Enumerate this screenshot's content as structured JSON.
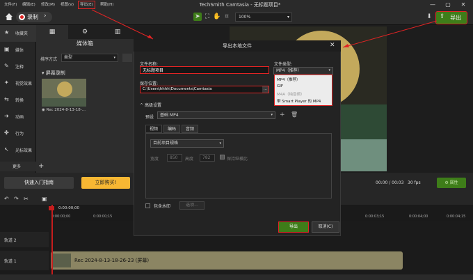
{
  "menu": {
    "items": [
      "文件(F)",
      "编辑(E)",
      "修改(M)",
      "视图(V)",
      "导出(E)",
      "帮助(H)"
    ],
    "highlighted_index": 4
  },
  "window": {
    "title": "TechSmith Camtasia - 无标题项目*",
    "minimize": "—",
    "maximize": "▢",
    "close": "✕"
  },
  "toolbar": {
    "record_label": "录制",
    "zoom_value": "100%",
    "export_label": "导出"
  },
  "sidebar": {
    "items": [
      {
        "label": "收藏夹",
        "icon": "star-icon",
        "glyph": "★"
      },
      {
        "label": "媒体",
        "icon": "media-icon",
        "glyph": "▣"
      },
      {
        "label": "注释",
        "icon": "annotation-icon",
        "glyph": "✎"
      },
      {
        "label": "视觉效果",
        "icon": "visual-effects-icon",
        "glyph": "✦"
      },
      {
        "label": "转换",
        "icon": "transition-icon",
        "glyph": "⇆"
      },
      {
        "label": "动画",
        "icon": "animation-icon",
        "glyph": "➜"
      },
      {
        "label": "行为",
        "icon": "behavior-icon",
        "glyph": "✤"
      },
      {
        "label": "光标效果",
        "icon": "cursor-effects-icon",
        "glyph": "↖"
      }
    ],
    "more_label": "更多"
  },
  "media_bin": {
    "title": "媒体箱",
    "sort_label": "排序方式",
    "sort_value": "类型",
    "section_label": "屏幕录制",
    "thumb_caption": "Rec 2024-8-13-18-..."
  },
  "strip": {
    "guide_label": "快速入门指南",
    "buy_label": "立即购买!",
    "timecode": "00:00 / 00:03",
    "fps": "30 fps",
    "properties_label": "属性"
  },
  "timeline": {
    "ticks": [
      "0:00:00;00",
      "0:00:00;15",
      "0:00:03;15",
      "0:00:04;00",
      "0:00:04;15"
    ],
    "playhead_time": "0:00:00;00",
    "track2_label": "轨道 2",
    "track1_label": "轨道 1",
    "clip_label": "Rec 2024-8-13-18-26-23 (屏幕)"
  },
  "dialog": {
    "title": "导出本地文件",
    "close": "✕",
    "filename_label": "文件名称:",
    "filename_value": "无标题项目",
    "path_label": "保存位置:",
    "path_value": "C:\\Users\\hhhh\\Documents\\Camtasia",
    "type_label": "文件类型:",
    "type_value": "MP4（推荐）",
    "type_options": [
      "MP4（推荐）",
      "GIF",
      "M4A（纯音频）",
      "带 Smart Player 的 MP4"
    ],
    "advanced_label": "高级设置",
    "preset_label": "预设",
    "preset_value": "基础 MP4",
    "tabs": [
      "视频",
      "编码",
      "音频"
    ],
    "project_size": "目前项目规格",
    "width_label": "宽度",
    "width_value": "850",
    "height_label": "高度",
    "height_value": "782",
    "keep_ratio_label": "保持纵横比",
    "watermark_label": "包含水印",
    "watermark_options": "选项...",
    "export_label": "导出",
    "cancel_label": "取消(C)"
  },
  "colors": {
    "accent_green": "#3e7d19",
    "highlight_red": "#e02424",
    "buy_orange": "#f7b733",
    "playhead_red": "#c61d1d"
  }
}
